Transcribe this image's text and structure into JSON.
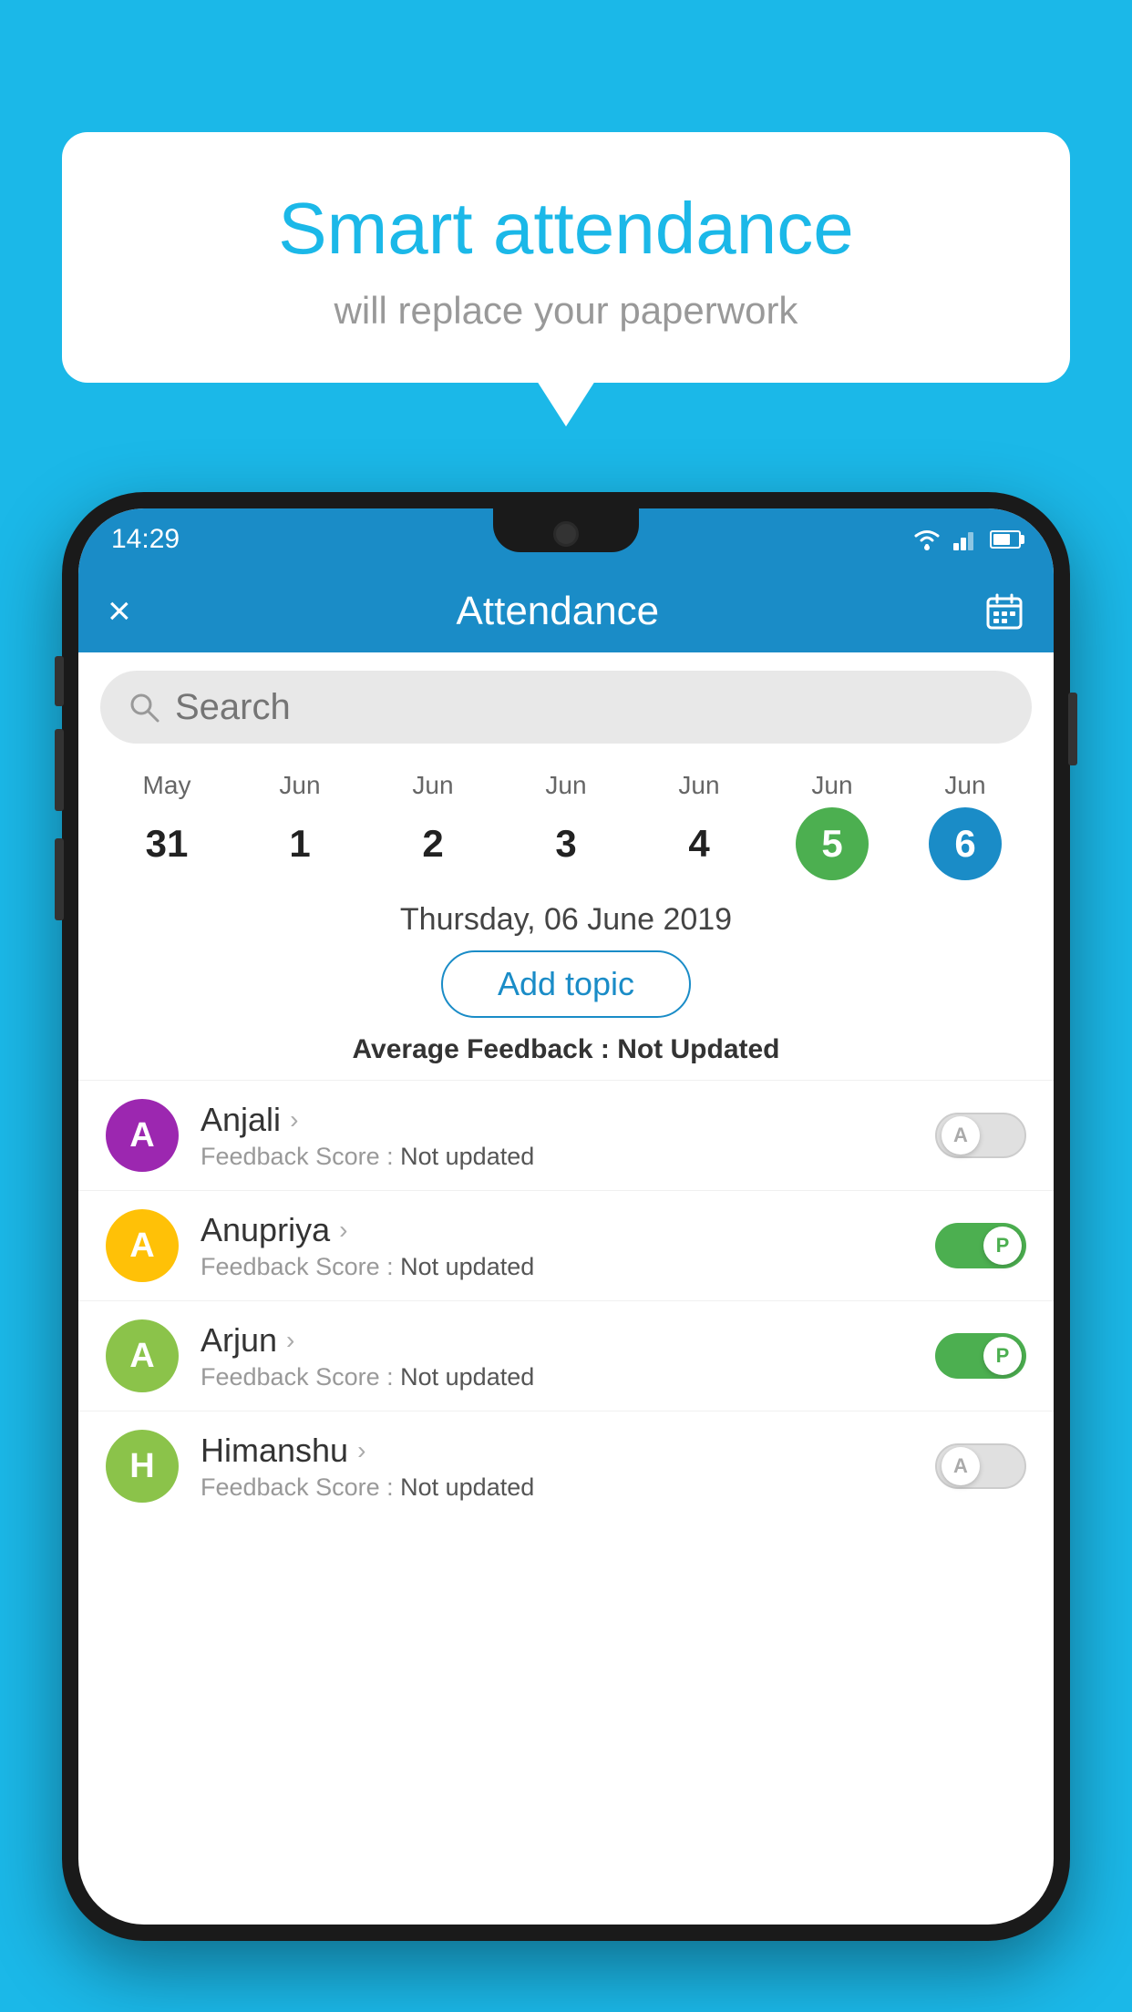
{
  "background": {
    "color": "#1bb8e8"
  },
  "speech_bubble": {
    "title": "Smart attendance",
    "subtitle": "will replace your paperwork"
  },
  "status_bar": {
    "time": "14:29",
    "wifi": "wifi-icon",
    "signal": "signal-icon",
    "battery": "battery-icon"
  },
  "app_header": {
    "close_label": "×",
    "title": "Attendance",
    "calendar_icon": "calendar-icon"
  },
  "search": {
    "placeholder": "Search"
  },
  "calendar": {
    "dates": [
      {
        "month": "May",
        "day": "31",
        "state": "normal"
      },
      {
        "month": "Jun",
        "day": "1",
        "state": "normal"
      },
      {
        "month": "Jun",
        "day": "2",
        "state": "normal"
      },
      {
        "month": "Jun",
        "day": "3",
        "state": "normal"
      },
      {
        "month": "Jun",
        "day": "4",
        "state": "normal"
      },
      {
        "month": "Jun",
        "day": "5",
        "state": "today"
      },
      {
        "month": "Jun",
        "day": "6",
        "state": "selected"
      }
    ]
  },
  "selected_date": {
    "label": "Thursday, 06 June 2019"
  },
  "add_topic": {
    "label": "Add topic"
  },
  "average_feedback": {
    "label": "Average Feedback :",
    "value": "Not Updated"
  },
  "students": [
    {
      "name": "Anjali",
      "avatar_letter": "A",
      "avatar_color": "#9c27b0",
      "feedback_label": "Feedback Score :",
      "feedback_value": "Not updated",
      "toggle_state": "off",
      "toggle_label": "A"
    },
    {
      "name": "Anupriya",
      "avatar_letter": "A",
      "avatar_color": "#ffc107",
      "feedback_label": "Feedback Score :",
      "feedback_value": "Not updated",
      "toggle_state": "on",
      "toggle_label": "P"
    },
    {
      "name": "Arjun",
      "avatar_letter": "A",
      "avatar_color": "#8bc34a",
      "feedback_label": "Feedback Score :",
      "feedback_value": "Not updated",
      "toggle_state": "on",
      "toggle_label": "P"
    },
    {
      "name": "Himanshu",
      "avatar_letter": "H",
      "avatar_color": "#8bc34a",
      "feedback_label": "Feedback Score :",
      "feedback_value": "Not updated",
      "toggle_state": "off",
      "toggle_label": "A"
    }
  ]
}
